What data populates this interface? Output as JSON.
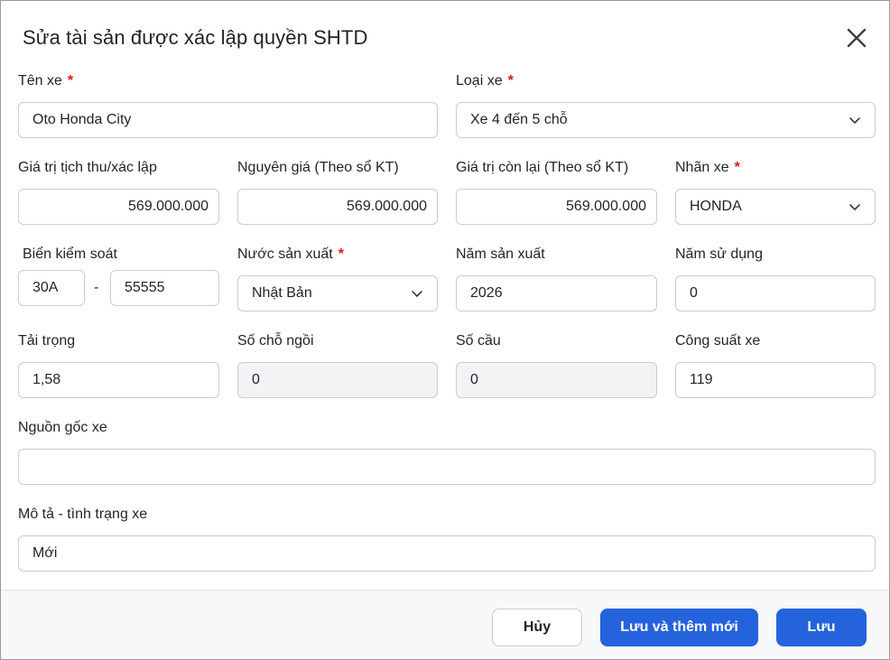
{
  "dialog": {
    "title": "Sửa tài sản được xác lập quyền SHTD",
    "close_icon": "close-icon"
  },
  "form": {
    "ten_xe": {
      "label": "Tên xe",
      "required": "*",
      "value": "Oto Honda City"
    },
    "loai_xe": {
      "label": "Loại xe",
      "required": "*",
      "value": "Xe 4 đến 5 chỗ"
    },
    "gia_tri_tich_thu": {
      "label": "Giá trị tịch thu/xác lập",
      "value": "569.000.000"
    },
    "nguyen_gia": {
      "label": "Nguyên giá (Theo sổ KT)",
      "value": "569.000.000"
    },
    "gia_tri_con_lai": {
      "label": "Giá trị còn lại (Theo sổ KT)",
      "value": "569.000.000"
    },
    "nhan_xe": {
      "label": "Nhãn xe",
      "required": "*",
      "value": "HONDA"
    },
    "bien_kiem_soat": {
      "label": "Biển kiểm soát",
      "prefix": "30A",
      "separator": "-",
      "number": "55555"
    },
    "nuoc_san_xuat": {
      "label": "Nước sản xuất",
      "required": "*",
      "value": "Nhật Bản"
    },
    "nam_san_xuat": {
      "label": "Năm sản xuất",
      "value": "2026"
    },
    "nam_su_dung": {
      "label": "Năm sử dụng",
      "value": "0"
    },
    "tai_trong": {
      "label": "Tải trọng",
      "value": "1,58"
    },
    "so_cho_ngoi": {
      "label": "Số chỗ ngồi",
      "value": "0"
    },
    "so_cau": {
      "label": "Số cầu",
      "value": "0"
    },
    "cong_suat_xe": {
      "label": "Công suất xe",
      "value": "119"
    },
    "nguon_goc_xe": {
      "label": "Nguồn gốc xe",
      "value": ""
    },
    "mo_ta": {
      "label": "Mô tả - tình trạng xe",
      "value": "Mới"
    }
  },
  "footer": {
    "cancel_label": "Hủy",
    "save_new_label": "Lưu và thêm mới",
    "save_label": "Lưu"
  },
  "colors": {
    "primary": "#2563dc",
    "required": "#e5141a",
    "disabled_bg": "#f2f3f4",
    "border": "#c9ccd1"
  }
}
